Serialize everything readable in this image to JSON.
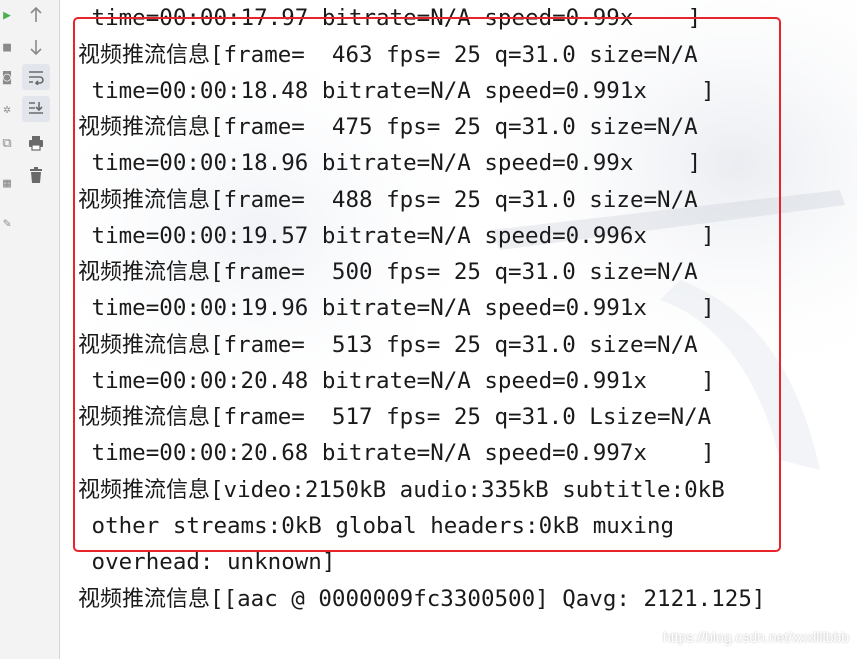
{
  "toolbar": {
    "buttons": [
      {
        "icon": "arrow-up-icon"
      },
      {
        "icon": "arrow-down-icon"
      },
      {
        "icon": "soft-wrap-icon"
      },
      {
        "icon": "scroll-to-end-icon"
      },
      {
        "icon": "print-icon"
      },
      {
        "icon": "trash-icon"
      }
    ],
    "left_icons": [
      "run-icon",
      "stop-icon",
      "camera-icon",
      "settings-icon",
      "restore-layout-icon",
      "layout-icon",
      "pin-icon"
    ]
  },
  "console": {
    "lines": [
      {
        "prefix": "",
        "text": " time=00:00:17.97 bitrate=N/A speed=0.99x    ]"
      },
      {
        "prefix": "视频推流信息",
        "text": "[frame=  463 fps= 25 q=31.0 size=N/A"
      },
      {
        "prefix": "",
        "text": " time=00:00:18.48 bitrate=N/A speed=0.991x    ]"
      },
      {
        "prefix": "视频推流信息",
        "text": "[frame=  475 fps= 25 q=31.0 size=N/A"
      },
      {
        "prefix": "",
        "text": " time=00:00:18.96 bitrate=N/A speed=0.99x    ]"
      },
      {
        "prefix": "视频推流信息",
        "text": "[frame=  488 fps= 25 q=31.0 size=N/A"
      },
      {
        "prefix": "",
        "text": " time=00:00:19.57 bitrate=N/A speed=0.996x    ]"
      },
      {
        "prefix": "视频推流信息",
        "text": "[frame=  500 fps= 25 q=31.0 size=N/A"
      },
      {
        "prefix": "",
        "text": " time=00:00:19.96 bitrate=N/A speed=0.991x    ]"
      },
      {
        "prefix": "视频推流信息",
        "text": "[frame=  513 fps= 25 q=31.0 size=N/A"
      },
      {
        "prefix": "",
        "text": " time=00:00:20.48 bitrate=N/A speed=0.991x    ]"
      },
      {
        "prefix": "视频推流信息",
        "text": "[frame=  517 fps= 25 q=31.0 Lsize=N/A"
      },
      {
        "prefix": "",
        "text": " time=00:00:20.68 bitrate=N/A speed=0.997x    ]"
      },
      {
        "prefix": "视频推流信息",
        "text": "[video:2150kB audio:335kB subtitle:0kB"
      },
      {
        "prefix": "",
        "text": " other streams:0kB global headers:0kB muxing"
      },
      {
        "prefix": "",
        "text": " overhead: unknown]"
      },
      {
        "prefix": "视频推流信息",
        "text": "[[aac @ 0000009fc3300500] Qavg: 2121.125]"
      }
    ]
  },
  "watermark": "https://blog.csdn.net/xxxllllbbb",
  "colors": {
    "highlight_border": "#e8242a",
    "text": "#1a1a1a",
    "toolbar_bg": "#f3f3f3"
  }
}
